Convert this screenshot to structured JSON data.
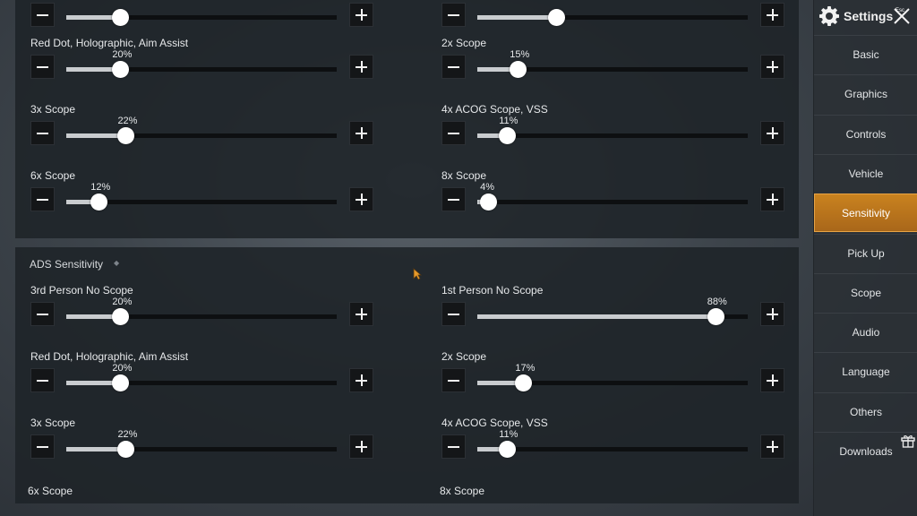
{
  "sections": {
    "top": {
      "settings": [
        {
          "label": "",
          "value": 20,
          "text": ""
        },
        {
          "label": "",
          "value": 29,
          "text": ""
        },
        {
          "label": "Red Dot, Holographic, Aim Assist",
          "value": 20,
          "text": "20%"
        },
        {
          "label": "2x Scope",
          "value": 15,
          "text": "15%"
        },
        {
          "label": "3x Scope",
          "value": 22,
          "text": "22%"
        },
        {
          "label": "4x ACOG Scope, VSS",
          "value": 11,
          "text": "11%"
        },
        {
          "label": "6x Scope",
          "value": 12,
          "text": "12%"
        },
        {
          "label": "8x Scope",
          "value": 4,
          "text": "4%"
        }
      ]
    },
    "ads": {
      "title": "ADS Sensitivity",
      "settings": [
        {
          "label": "3rd Person No Scope",
          "value": 20,
          "text": "20%"
        },
        {
          "label": "1st Person No Scope",
          "value": 88,
          "text": "88%"
        },
        {
          "label": "Red Dot, Holographic, Aim Assist",
          "value": 20,
          "text": "20%"
        },
        {
          "label": "2x Scope",
          "value": 17,
          "text": "17%"
        },
        {
          "label": "3x Scope",
          "value": 22,
          "text": "22%"
        },
        {
          "label": "4x ACOG Scope, VSS",
          "value": 11,
          "text": "11%"
        }
      ],
      "cutoff_labels": [
        "6x Scope",
        "8x Scope"
      ]
    }
  },
  "sidebar": {
    "title": "Settings",
    "esc_label": "Esc",
    "items": [
      {
        "label": "Basic",
        "active": false
      },
      {
        "label": "Graphics",
        "active": false
      },
      {
        "label": "Controls",
        "active": false
      },
      {
        "label": "Vehicle",
        "active": false
      },
      {
        "label": "Sensitivity",
        "active": true
      },
      {
        "label": "Pick Up",
        "active": false
      },
      {
        "label": "Scope",
        "active": false
      },
      {
        "label": "Audio",
        "active": false
      },
      {
        "label": "Language",
        "active": false
      },
      {
        "label": "Others",
        "active": false
      },
      {
        "label": "Downloads",
        "active": false
      }
    ]
  },
  "icons": {
    "gear": "gear-icon",
    "close": "close-icon",
    "gift": "gift-icon",
    "cursor": "cursor-icon"
  },
  "colors": {
    "accent": "#c9821f",
    "panel": "#1e2328",
    "track": "#0d0f11",
    "fill": "#c9cccf"
  }
}
